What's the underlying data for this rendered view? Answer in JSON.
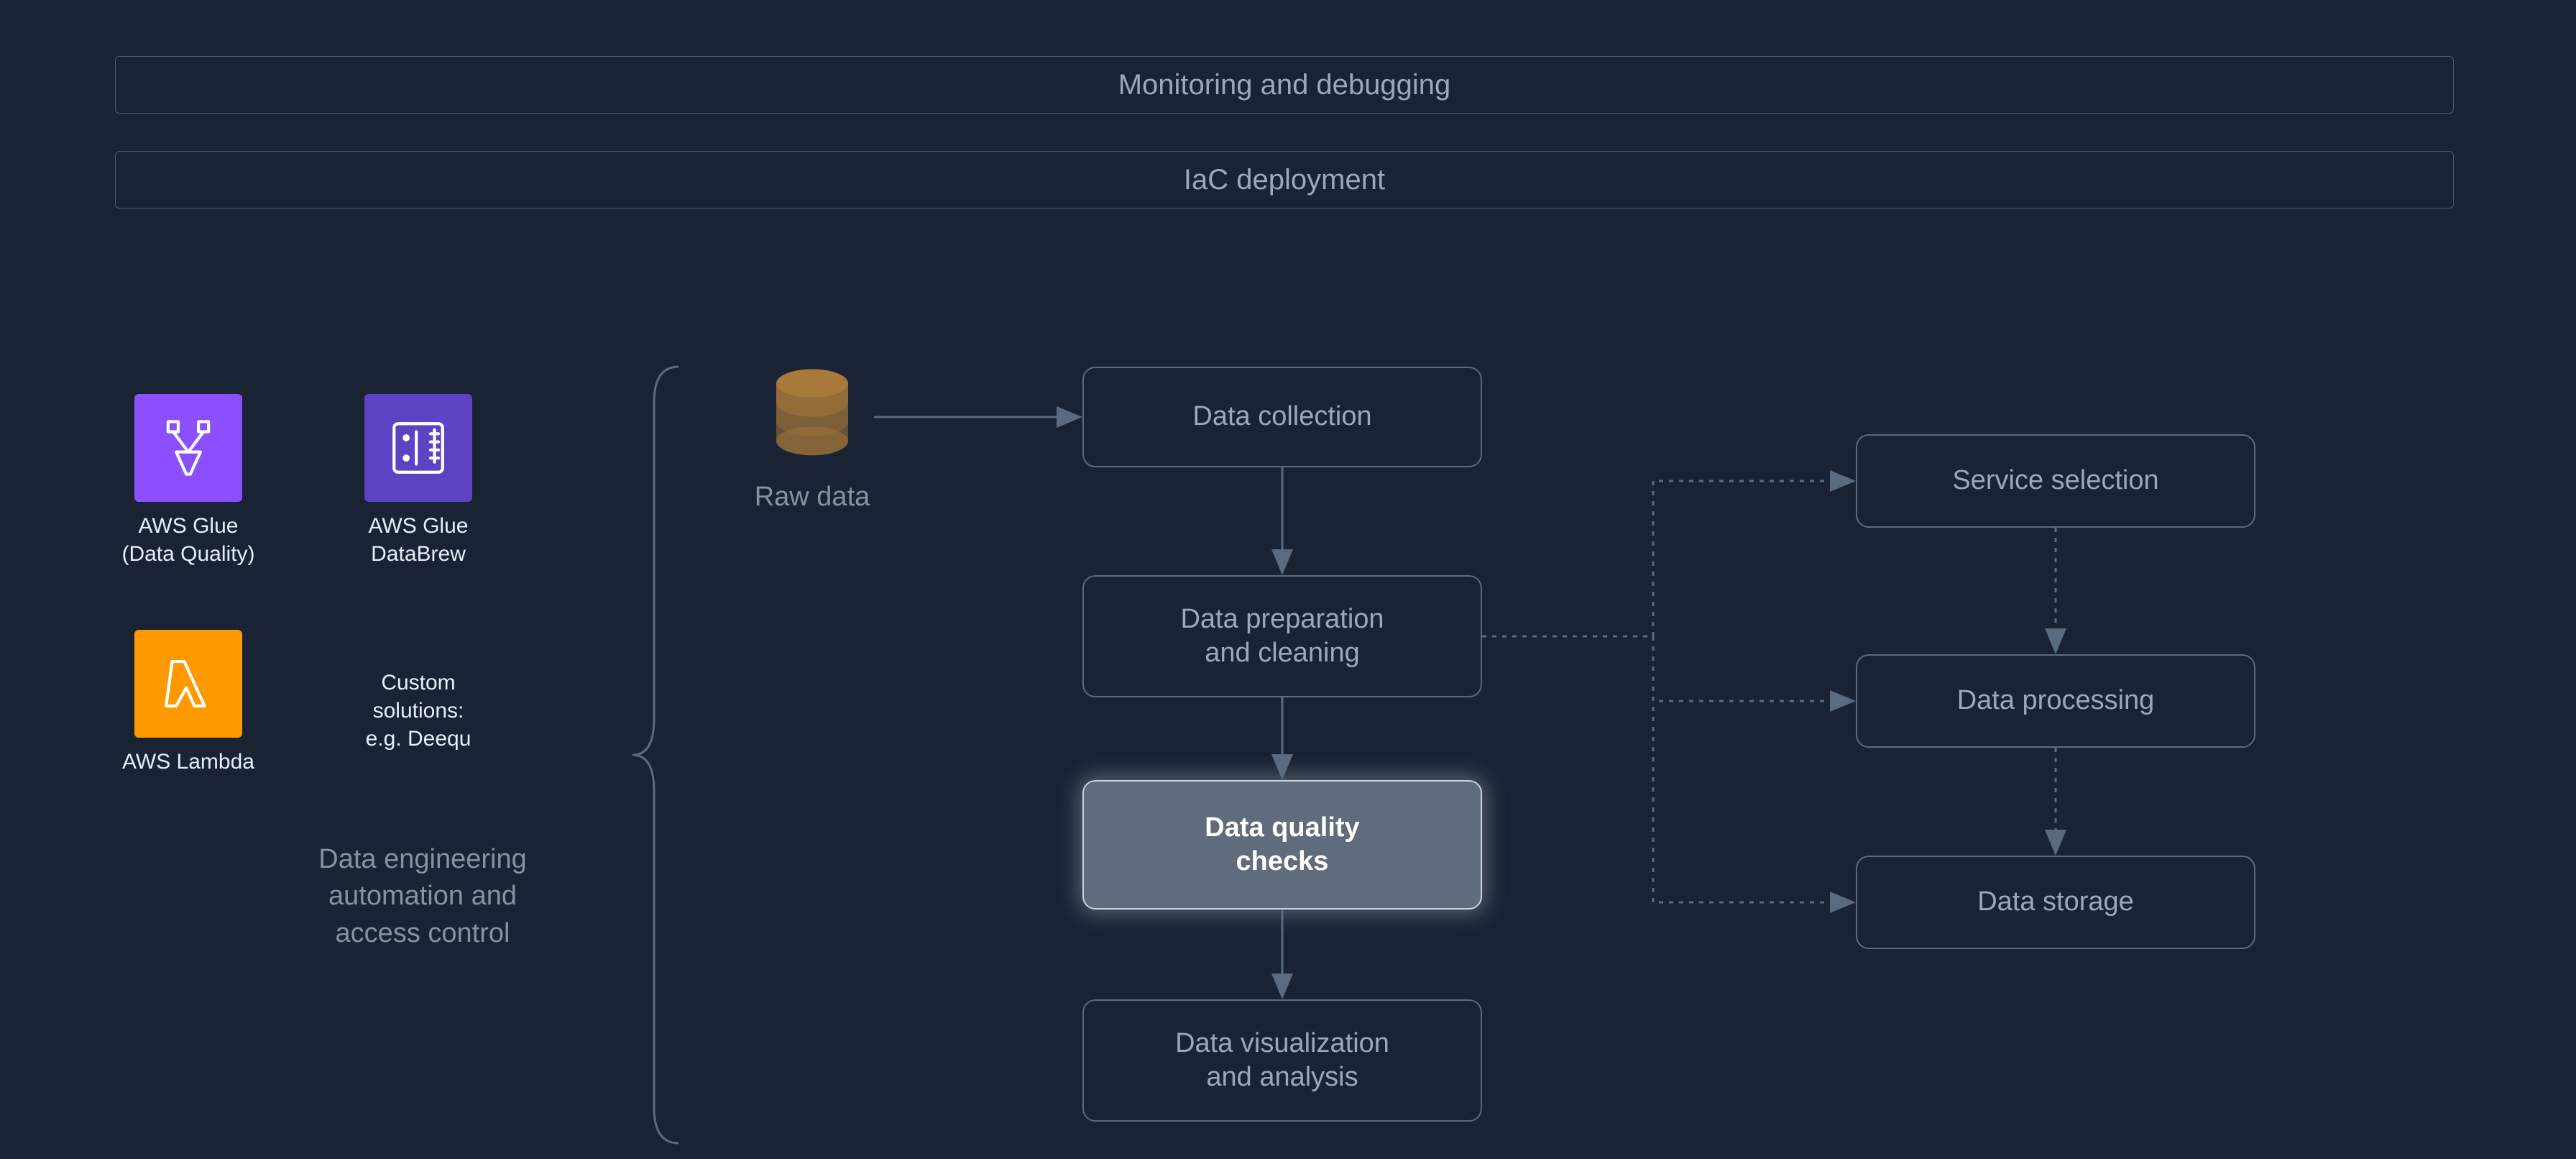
{
  "banners": {
    "monitoring": "Monitoring and debugging",
    "iac": "IaC deployment"
  },
  "services": {
    "glue_dq": {
      "line1": "AWS Glue",
      "line2": "(Data Quality)"
    },
    "glue_db": {
      "line1": "AWS Glue",
      "line2": "DataBrew"
    },
    "lambda": {
      "line1": "AWS Lambda"
    },
    "custom": {
      "line1": "Custom",
      "line2": "solutions:",
      "line3": "e.g. Deequ"
    }
  },
  "brace_title": {
    "line1": "Data engineering",
    "line2": "automation and",
    "line3": "access control"
  },
  "rawdata_label": "Raw data",
  "nodes": {
    "collection": "Data collection",
    "prep": {
      "line1": "Data preparation",
      "line2": "and cleaning"
    },
    "quality": {
      "line1": "Data quality",
      "line2": "checks"
    },
    "viz": {
      "line1": "Data visualization",
      "line2": "and analysis"
    },
    "svc_sel": "Service selection",
    "processing": "Data processing",
    "storage": "Data storage"
  },
  "colors": {
    "purple": "#8c4fff",
    "purple2": "#5d42c4",
    "orange": "#ff9900"
  }
}
